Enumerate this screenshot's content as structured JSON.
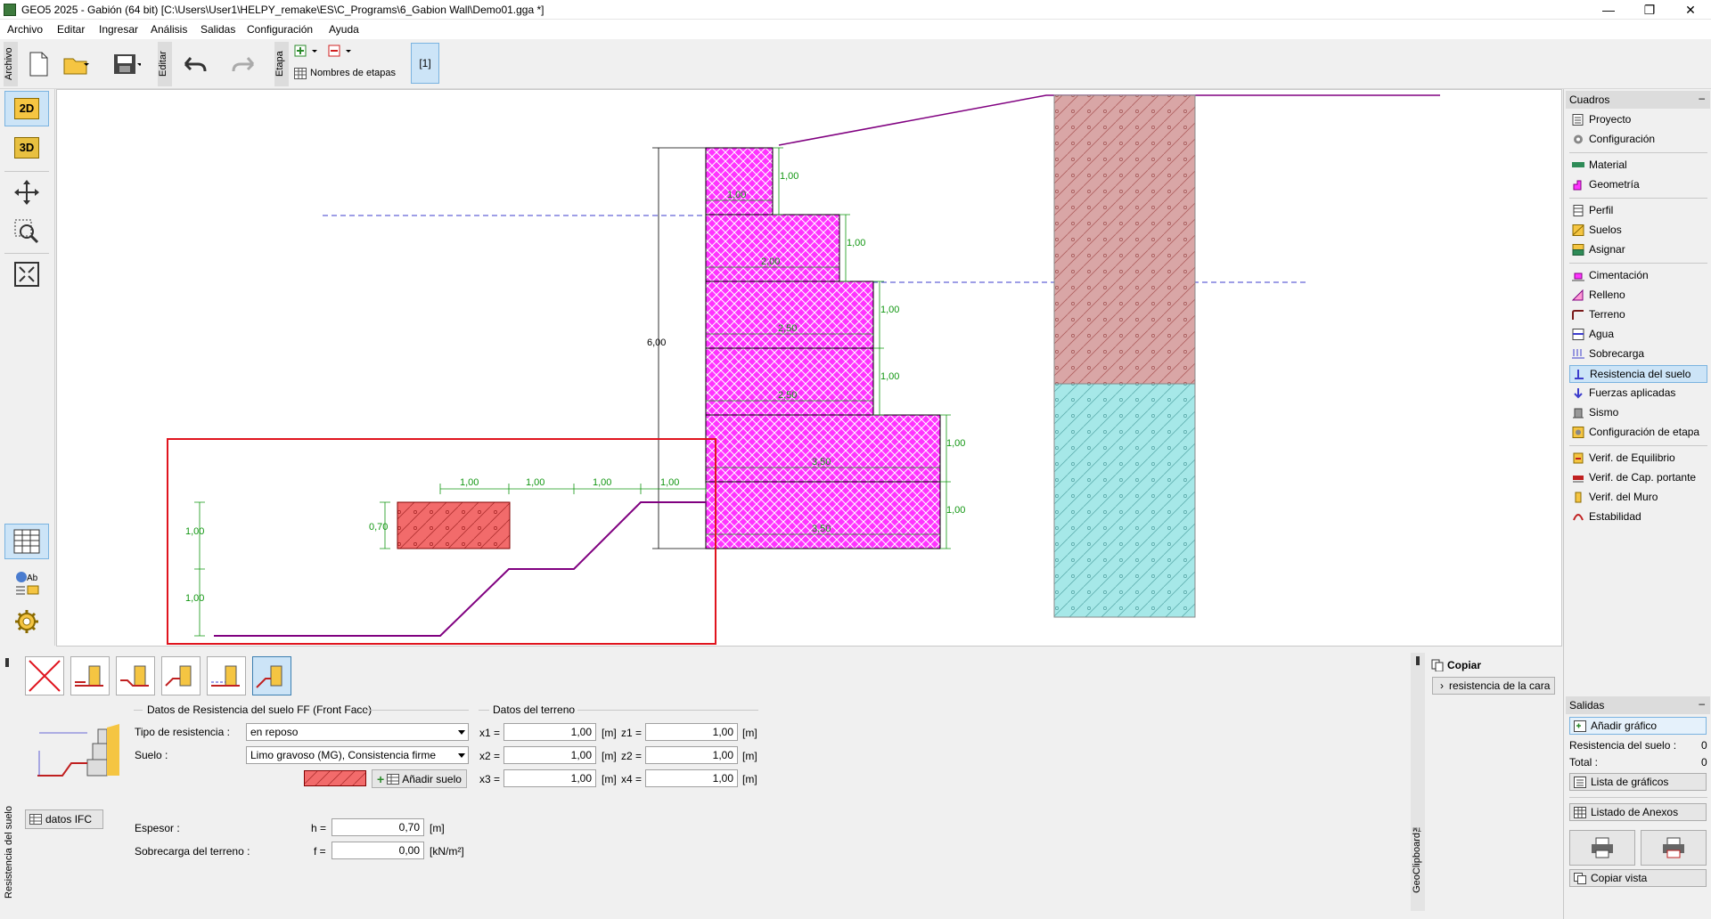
{
  "window": {
    "title": "GEO5 2025 - Gabión (64 bit) [C:\\Users\\User1\\HELPY_remake\\ES\\C_Programs\\6_Gabion Wall\\Demo01.gga *]",
    "minimize": "—",
    "restore": "❐",
    "close": "✕"
  },
  "menu": [
    "Archivo",
    "Editar",
    "Ingresar",
    "Análisis",
    "Salidas",
    "Configuración",
    "Ayuda"
  ],
  "toolbar": {
    "archivo_label": "Archivo",
    "editar_label": "Editar",
    "etapa_label": "Etapa",
    "stage_names_label": "Nombres de etapas",
    "current_stage": "[1]"
  },
  "left_tools": {
    "view2d": "2D",
    "view3d": "3D"
  },
  "drawing": {
    "wall_height": "6,00",
    "step_heights": [
      "1,00",
      "1,00",
      "1,00",
      "1,00",
      "1,00",
      "1,00"
    ],
    "step_widths": [
      "1,00",
      "2,00",
      "2,50",
      "2,50",
      "3,50",
      "3,50"
    ],
    "terrain_dims_x": [
      "1,00",
      "1,00",
      "1,00",
      "1,00"
    ],
    "terrain_dims_z": [
      "1,00",
      "1,00"
    ],
    "soil_thickness": "0,70"
  },
  "bottom": {
    "panel_title": "Resistencia del suelo",
    "group_resistance": "Datos de Resistencia del suelo FF (Front Face)",
    "group_terrain": "Datos del terreno",
    "resistance_type_label": "Tipo de resistencia :",
    "resistance_type_value": "en reposo",
    "soil_label": "Suelo :",
    "soil_value": "Limo gravoso (MG), Consistencia firme",
    "add_soil": "Añadir suelo",
    "ifc_button": "datos IFC",
    "thickness_label": "Espesor :",
    "thickness_sym": "h =",
    "thickness_value": "0,70",
    "thickness_unit": "[m]",
    "surcharge_label": "Sobrecarga del terreno :",
    "surcharge_sym": "f =",
    "surcharge_value": "0,00",
    "surcharge_unit": "[kN/m²]",
    "x1_label": "x1 =",
    "x1": "1,00",
    "x2_label": "x2 =",
    "x2": "1,00",
    "x3_label": "x3 =",
    "x3": "1,00",
    "z1_label": "z1 =",
    "z1": "1,00",
    "z2_label": "z2 =",
    "z2": "1,00",
    "x4_label": "x4 =",
    "x4": "1,00",
    "unit_m": "[m]"
  },
  "clipboard": {
    "title": "Copiar",
    "item": "resistencia de la cara",
    "vertical_label": "GeoClipboard™"
  },
  "sidebar": {
    "cuadros_title": "Cuadros",
    "groups": [
      [
        "Proyecto",
        "Configuración"
      ],
      [
        "Material",
        "Geometría"
      ],
      [
        "Perfil",
        "Suelos",
        "Asignar"
      ],
      [
        "Cimentación",
        "Relleno",
        "Terreno",
        "Agua",
        "Sobrecarga",
        "Resistencia del suelo",
        "Fuerzas aplicadas",
        "Sismo",
        "Configuración de etapa"
      ],
      [
        "Verif. de Equilibrio",
        "Verif. de Cap. portante",
        "Verif. del Muro",
        "Estabilidad"
      ]
    ],
    "salidas_title": "Salidas",
    "add_graphic": "Añadir gráfico",
    "resistance_count_label": "Resistencia del suelo :",
    "resistance_count": "0",
    "total_label": "Total :",
    "total": "0",
    "graphics_list": "Lista de gráficos",
    "annex_list": "Listado de Anexos",
    "copy_view": "Copiar vista"
  },
  "colors": {
    "gabion_fill": "#ff33ff",
    "soil_upper": "#d9a6a6",
    "soil_lower": "#a6e8e8",
    "resistance_fill": "#f26b6b",
    "highlight_red": "#e0141e",
    "terrain": "#800080",
    "dim_green": "#119611",
    "water": "#3c3ccc"
  }
}
